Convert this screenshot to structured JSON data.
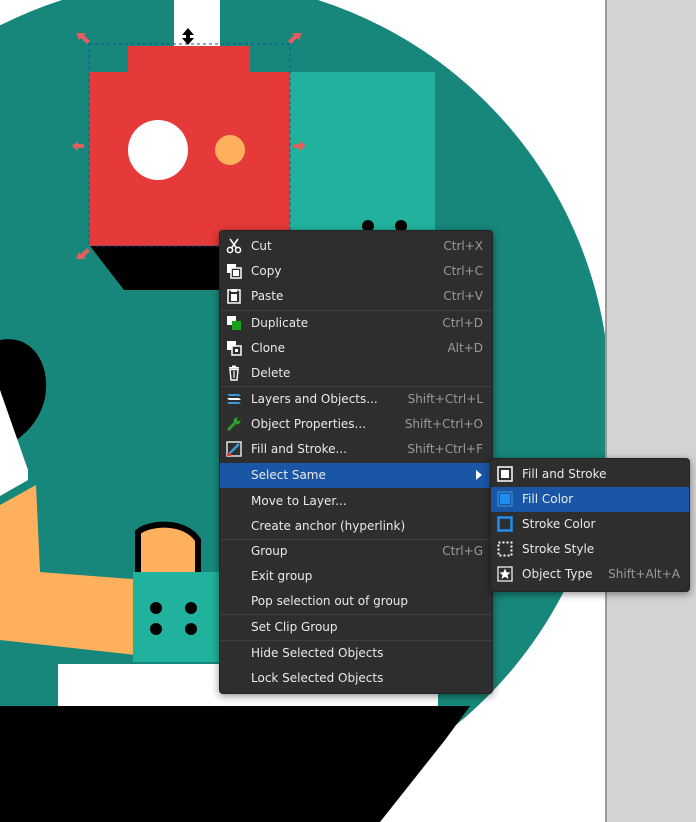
{
  "context_menu": {
    "items": [
      {
        "label": "Cut",
        "shortcut": "Ctrl+X",
        "icon": "scissors-icon"
      },
      {
        "label": "Copy",
        "shortcut": "Ctrl+C",
        "icon": "copy-icon"
      },
      {
        "label": "Paste",
        "shortcut": "Ctrl+V",
        "icon": "paste-icon"
      },
      {
        "label": "Duplicate",
        "shortcut": "Ctrl+D",
        "icon": "duplicate-icon"
      },
      {
        "label": "Clone",
        "shortcut": "Alt+D",
        "icon": "clone-icon"
      },
      {
        "label": "Delete",
        "shortcut": "",
        "icon": "trash-icon"
      },
      {
        "label": "Layers and Objects...",
        "shortcut": "Shift+Ctrl+L",
        "icon": "layers-icon"
      },
      {
        "label": "Object Properties...",
        "shortcut": "Shift+Ctrl+O",
        "icon": "wrench-icon"
      },
      {
        "label": "Fill and Stroke...",
        "shortcut": "Shift+Ctrl+F",
        "icon": "fill-stroke-icon"
      },
      {
        "label": "Select Same",
        "shortcut": "",
        "icon": ""
      },
      {
        "label": "Move to Layer...",
        "shortcut": "",
        "icon": ""
      },
      {
        "label": "Create anchor (hyperlink)",
        "shortcut": "",
        "icon": ""
      },
      {
        "label": "Group",
        "shortcut": "Ctrl+G",
        "icon": ""
      },
      {
        "label": "Exit group",
        "shortcut": "",
        "icon": ""
      },
      {
        "label": "Pop selection out of group",
        "shortcut": "",
        "icon": ""
      },
      {
        "label": "Set Clip Group",
        "shortcut": "",
        "icon": ""
      },
      {
        "label": "Hide Selected Objects",
        "shortcut": "",
        "icon": ""
      },
      {
        "label": "Lock Selected Objects",
        "shortcut": "",
        "icon": ""
      }
    ]
  },
  "submenu": {
    "items": [
      {
        "label": "Fill and Stroke",
        "shortcut": "",
        "icon": "fill-and-stroke-icon"
      },
      {
        "label": "Fill Color",
        "shortcut": "",
        "icon": "fill-color-icon"
      },
      {
        "label": "Stroke Color",
        "shortcut": "",
        "icon": "stroke-color-icon"
      },
      {
        "label": "Stroke Style",
        "shortcut": "",
        "icon": "stroke-style-icon"
      },
      {
        "label": "Object Type",
        "shortcut": "Shift+Alt+A",
        "icon": "star-icon"
      }
    ]
  },
  "colors": {
    "menu_bg": "#2e2e2e",
    "highlight": "#1a56a6",
    "teal": "#17877b",
    "mint": "#20b29c",
    "red": "#e63939",
    "orange": "#ffb05c"
  }
}
